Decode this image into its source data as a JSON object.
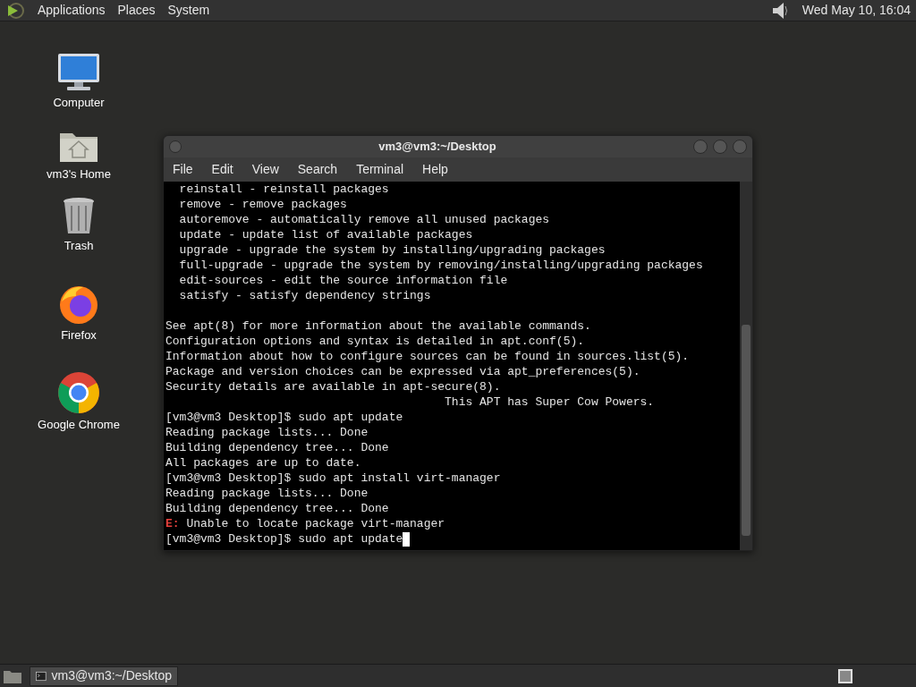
{
  "top_panel": {
    "menus": [
      "Applications",
      "Places",
      "System"
    ],
    "clock": "Wed May 10, 16:04"
  },
  "desktop_icons": [
    {
      "kind": "computer",
      "label": "Computer"
    },
    {
      "kind": "home",
      "label": "vm3's Home"
    },
    {
      "kind": "trash",
      "label": "Trash"
    },
    {
      "kind": "firefox",
      "label": "Firefox"
    },
    {
      "kind": "chrome",
      "label": "Google Chrome"
    }
  ],
  "terminal": {
    "title": "vm3@vm3:~/Desktop",
    "menus": [
      "File",
      "Edit",
      "View",
      "Search",
      "Terminal",
      "Help"
    ],
    "lines": [
      {
        "kind": "normal",
        "text": "  reinstall - reinstall packages"
      },
      {
        "kind": "normal",
        "text": "  remove - remove packages"
      },
      {
        "kind": "normal",
        "text": "  autoremove - automatically remove all unused packages"
      },
      {
        "kind": "normal",
        "text": "  update - update list of available packages"
      },
      {
        "kind": "normal",
        "text": "  upgrade - upgrade the system by installing/upgrading packages"
      },
      {
        "kind": "normal",
        "text": "  full-upgrade - upgrade the system by removing/installing/upgrading packages"
      },
      {
        "kind": "normal",
        "text": "  edit-sources - edit the source information file"
      },
      {
        "kind": "normal",
        "text": "  satisfy - satisfy dependency strings"
      },
      {
        "kind": "blank"
      },
      {
        "kind": "normal",
        "text": "See apt(8) for more information about the available commands."
      },
      {
        "kind": "normal",
        "text": "Configuration options and syntax is detailed in apt.conf(5)."
      },
      {
        "kind": "normal",
        "text": "Information about how to configure sources can be found in sources.list(5)."
      },
      {
        "kind": "normal",
        "text": "Package and version choices can be expressed via apt_preferences(5)."
      },
      {
        "kind": "normal",
        "text": "Security details are available in apt-secure(8)."
      },
      {
        "kind": "normal",
        "text": "                                        This APT has Super Cow Powers."
      },
      {
        "kind": "normal",
        "text": "[vm3@vm3 Desktop]$ sudo apt update"
      },
      {
        "kind": "normal",
        "text": "Reading package lists... Done"
      },
      {
        "kind": "normal",
        "text": "Building dependency tree... Done"
      },
      {
        "kind": "normal",
        "text": "All packages are up to date."
      },
      {
        "kind": "normal",
        "text": "[vm3@vm3 Desktop]$ sudo apt install virt-manager"
      },
      {
        "kind": "normal",
        "text": "Reading package lists... Done"
      },
      {
        "kind": "normal",
        "text": "Building dependency tree... Done"
      },
      {
        "kind": "error",
        "prefix": "E:",
        "text": " Unable to locate package virt-manager"
      },
      {
        "kind": "prompt",
        "text": "[vm3@vm3 Desktop]$ sudo apt update"
      }
    ]
  },
  "taskbar": {
    "tasks": [
      {
        "label": "vm3@vm3:~/Desktop",
        "selected": true
      }
    ]
  }
}
